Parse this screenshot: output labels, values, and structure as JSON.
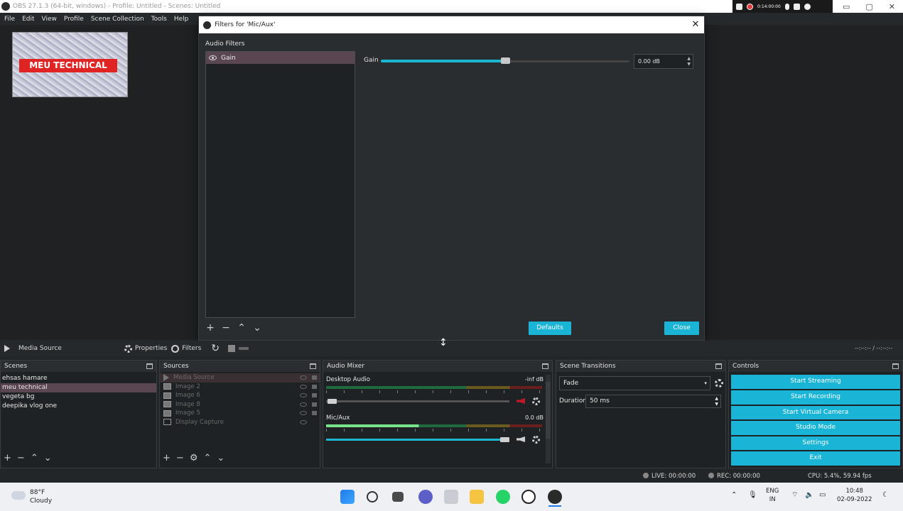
{
  "window": {
    "title": "OBS 27.1.3 (64-bit, windows) - Profile: Untitled - Scenes: Untitled"
  },
  "recorder": {
    "time": "0:14:00:00"
  },
  "menu": [
    "File",
    "Edit",
    "View",
    "Profile",
    "Scene Collection",
    "Tools",
    "Help"
  ],
  "preview": {
    "overlay_text": "MEU TECHNICAL"
  },
  "dialog": {
    "title": "Filters for 'Mic/Aux'",
    "section_label": "Audio Filters",
    "filters": [
      {
        "name": "Gain",
        "selected": true
      }
    ],
    "gain": {
      "label": "Gain",
      "value": "0.00 dB",
      "slider_fraction": 0.5
    },
    "defaults_label": "Defaults",
    "close_label": "Close"
  },
  "toolbar": {
    "source_name": "Media Source",
    "properties_label": "Properties",
    "filters_label": "Filters",
    "time": "--:--:-- / --:--:--"
  },
  "scenes": {
    "title": "Scenes",
    "items": [
      {
        "name": "ehsas hamare",
        "selected": false
      },
      {
        "name": "meu technical",
        "selected": true
      },
      {
        "name": "vegeta bg",
        "selected": false
      },
      {
        "name": "deepika vlog one",
        "selected": false
      }
    ]
  },
  "sources": {
    "title": "Sources",
    "items": [
      {
        "name": "Media Source",
        "icon": "play-icon"
      },
      {
        "name": "Image 2",
        "icon": "image-icon"
      },
      {
        "name": "Image 6",
        "icon": "image-icon"
      },
      {
        "name": "Image 8",
        "icon": "image-icon"
      },
      {
        "name": "Image 5",
        "icon": "image-icon"
      },
      {
        "name": "Display Capture",
        "icon": "monitor-icon"
      }
    ]
  },
  "mixer": {
    "title": "Audio Mixer",
    "tracks": [
      {
        "name": "Desktop Audio",
        "db": "-inf dB",
        "muted": true,
        "volume_fraction": 0.0
      },
      {
        "name": "Mic/Aux",
        "db": "0.0 dB",
        "muted": false,
        "volume_fraction": 1.0
      }
    ]
  },
  "transitions": {
    "title": "Scene Transitions",
    "selected": "Fade",
    "duration_label": "Duration",
    "duration_value": "50 ms"
  },
  "controls": {
    "title": "Controls",
    "buttons": [
      "Start Streaming",
      "Start Recording",
      "Start Virtual Camera",
      "Studio Mode",
      "Settings",
      "Exit"
    ]
  },
  "status": {
    "live": "LIVE: 00:00:00",
    "rec": "REC: 00:00:00",
    "cpu": "CPU: 5.4%, 59.94 fps"
  },
  "taskbar": {
    "weather_temp": "88°F",
    "weather_desc": "Cloudy",
    "lang_1": "ENG",
    "lang_2": "IN",
    "time": "10:48",
    "date": "02-09-2022"
  },
  "colors": {
    "accent": "#19b4d6",
    "selected_row": "#5a4650",
    "background": "#232628"
  }
}
